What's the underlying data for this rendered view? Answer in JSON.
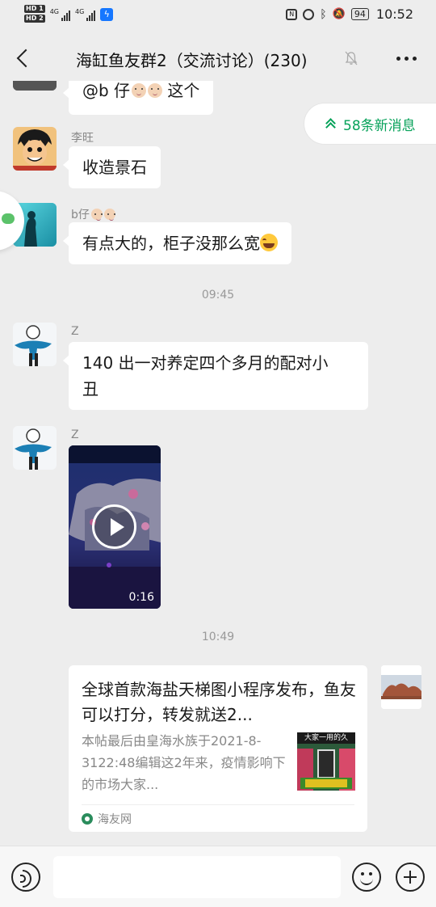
{
  "status_bar": {
    "sim1": "HD 1",
    "sim2": "HD 2",
    "net1": "4G",
    "net2": "4G",
    "battery": "94",
    "time": "10:52"
  },
  "nav": {
    "title": "海缸鱼友群2（交流讨论）(230)",
    "back_icon": "chevron-left-icon",
    "mute_icon": "bell-off-icon",
    "more_icon": "more-icon"
  },
  "new_messages": {
    "label": "58条新消息"
  },
  "messages": [
    {
      "type": "text",
      "sender": "",
      "text": "@b 仔",
      "suffix": " 这个"
    },
    {
      "type": "text",
      "sender": "李旺",
      "text": "收造景石"
    },
    {
      "type": "text",
      "sender": "b仔",
      "text": "有点大的，柜子没那么宽"
    },
    {
      "type": "time",
      "text": "09:45"
    },
    {
      "type": "text",
      "sender": "Z",
      "text_line1": "140 出一对养定四个多月的配对小",
      "text_line2": "丑"
    },
    {
      "type": "video",
      "sender": "Z",
      "duration": "0:16"
    },
    {
      "type": "time",
      "text": "10:49"
    },
    {
      "type": "link",
      "title": "全球首款海盐天梯图小程序发布，鱼友可以打分，转发就送2...",
      "description": "本帖最后由皇海水族于2021-8-3122:48编辑这2年来，疫情影响下的市场大家...",
      "thumb_text": "大家一用的久",
      "source": "海友网"
    }
  ],
  "input_bar": {
    "placeholder": "",
    "voice_icon": "voice-icon",
    "emoji_icon": "emoji-icon",
    "plus_icon": "plus-icon"
  },
  "colors": {
    "background": "#ededed",
    "bubble": "#ffffff",
    "accent_green": "#07a25a"
  }
}
